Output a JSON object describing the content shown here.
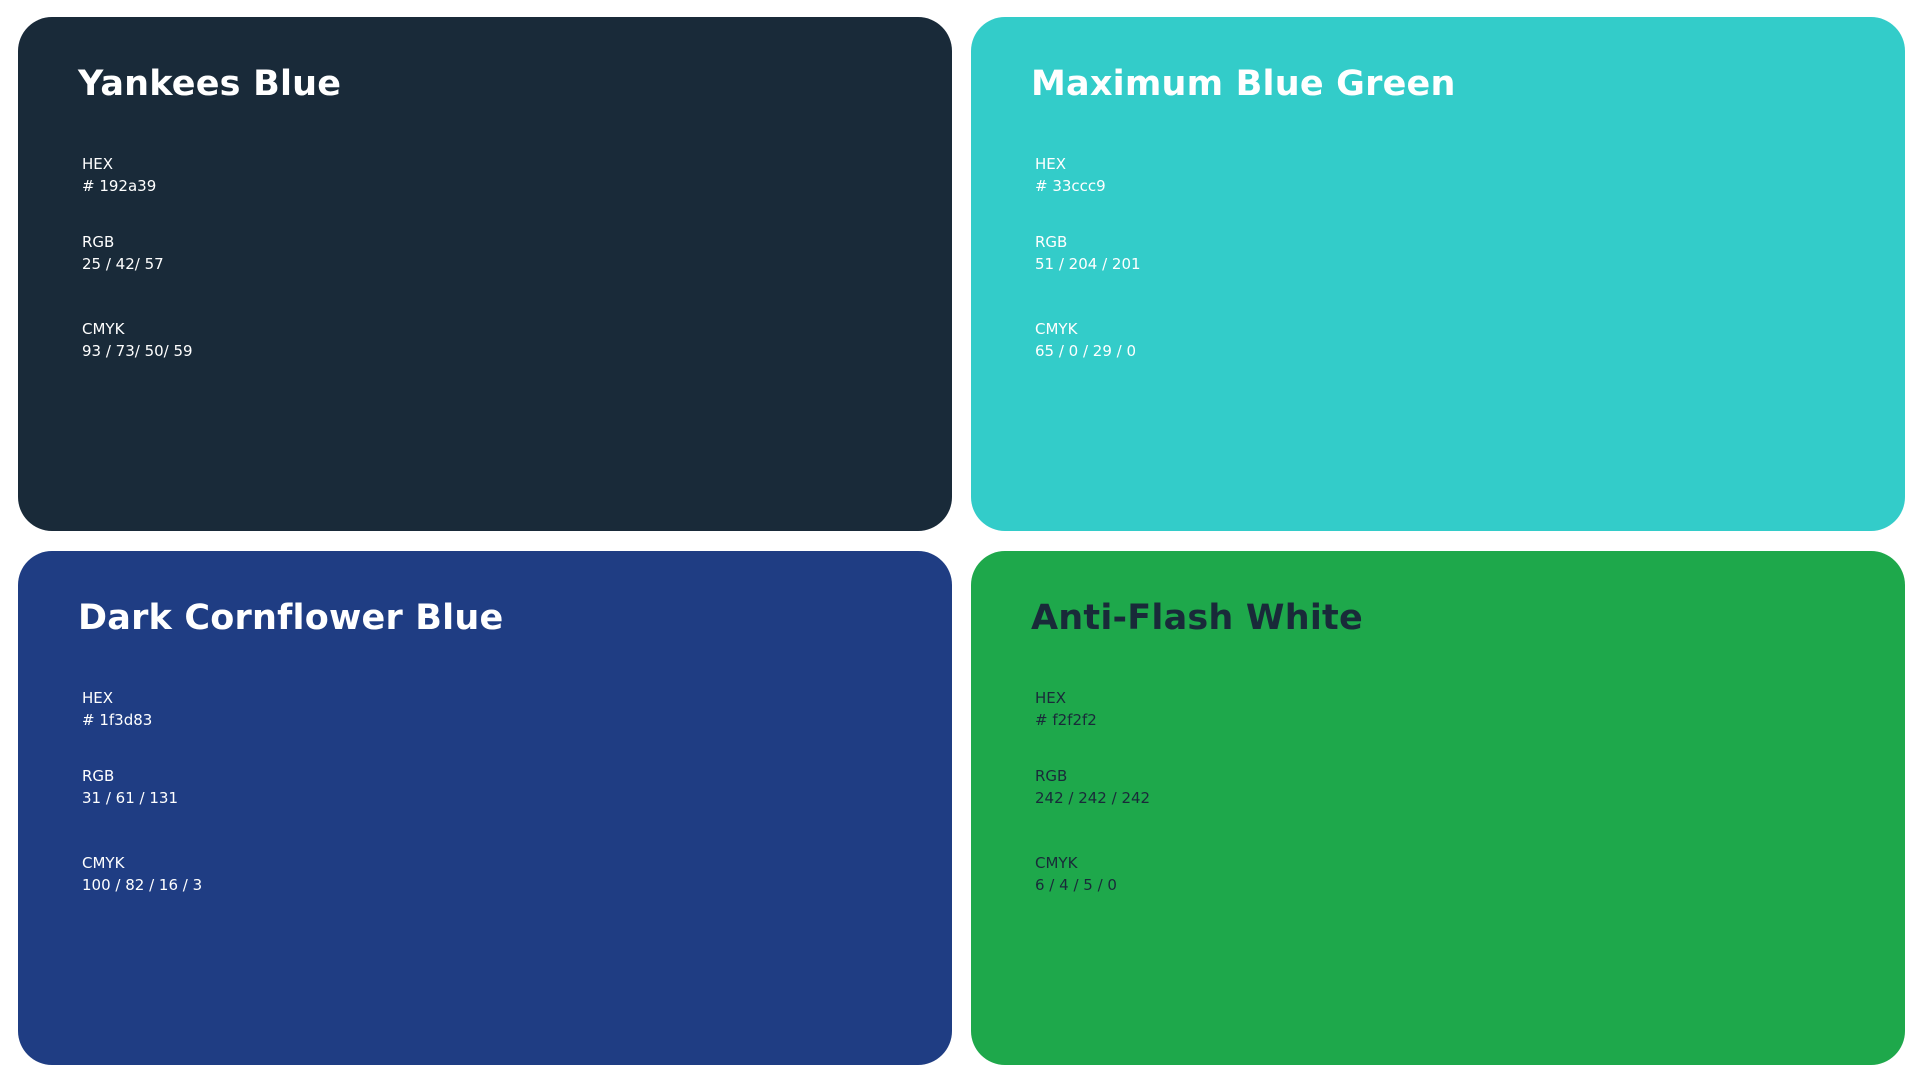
{
  "swatches": [
    {
      "name": "Yankees Blue",
      "background": "#192a39",
      "text_color": "#ffffff",
      "hex_label": "HEX",
      "hex_value": "# 192a39",
      "rgb_label": "RGB",
      "rgb_value": "25 / 42/ 57",
      "cmyk_label": "CMYK",
      "cmyk_value": "93 / 73/ 50/ 59"
    },
    {
      "name": "Maximum Blue Green",
      "background": "#33ccc9",
      "text_color": "#ffffff",
      "hex_label": "HEX",
      "hex_value": "# 33ccc9",
      "rgb_label": "RGB",
      "rgb_value": "51 / 204 / 201",
      "cmyk_label": "CMYK",
      "cmyk_value": "65 / 0 / 29 / 0"
    },
    {
      "name": "Dark Cornflower Blue",
      "background": "#1f3d83",
      "text_color": "#ffffff",
      "hex_label": "HEX",
      "hex_value": "# 1f3d83",
      "rgb_label": "RGB",
      "rgb_value": "31 / 61 / 131",
      "cmyk_label": "CMYK",
      "cmyk_value": "100 / 82 / 16 / 3"
    },
    {
      "name": "Anti-Flash White",
      "background": "#1ea84b",
      "text_color": "#192a39",
      "hex_label": "HEX",
      "hex_value": "# f2f2f2",
      "rgb_label": "RGB",
      "rgb_value": "242 / 242 / 242",
      "cmyk_label": "CMYK",
      "cmyk_value": "6 / 4 / 5 / 0"
    }
  ]
}
